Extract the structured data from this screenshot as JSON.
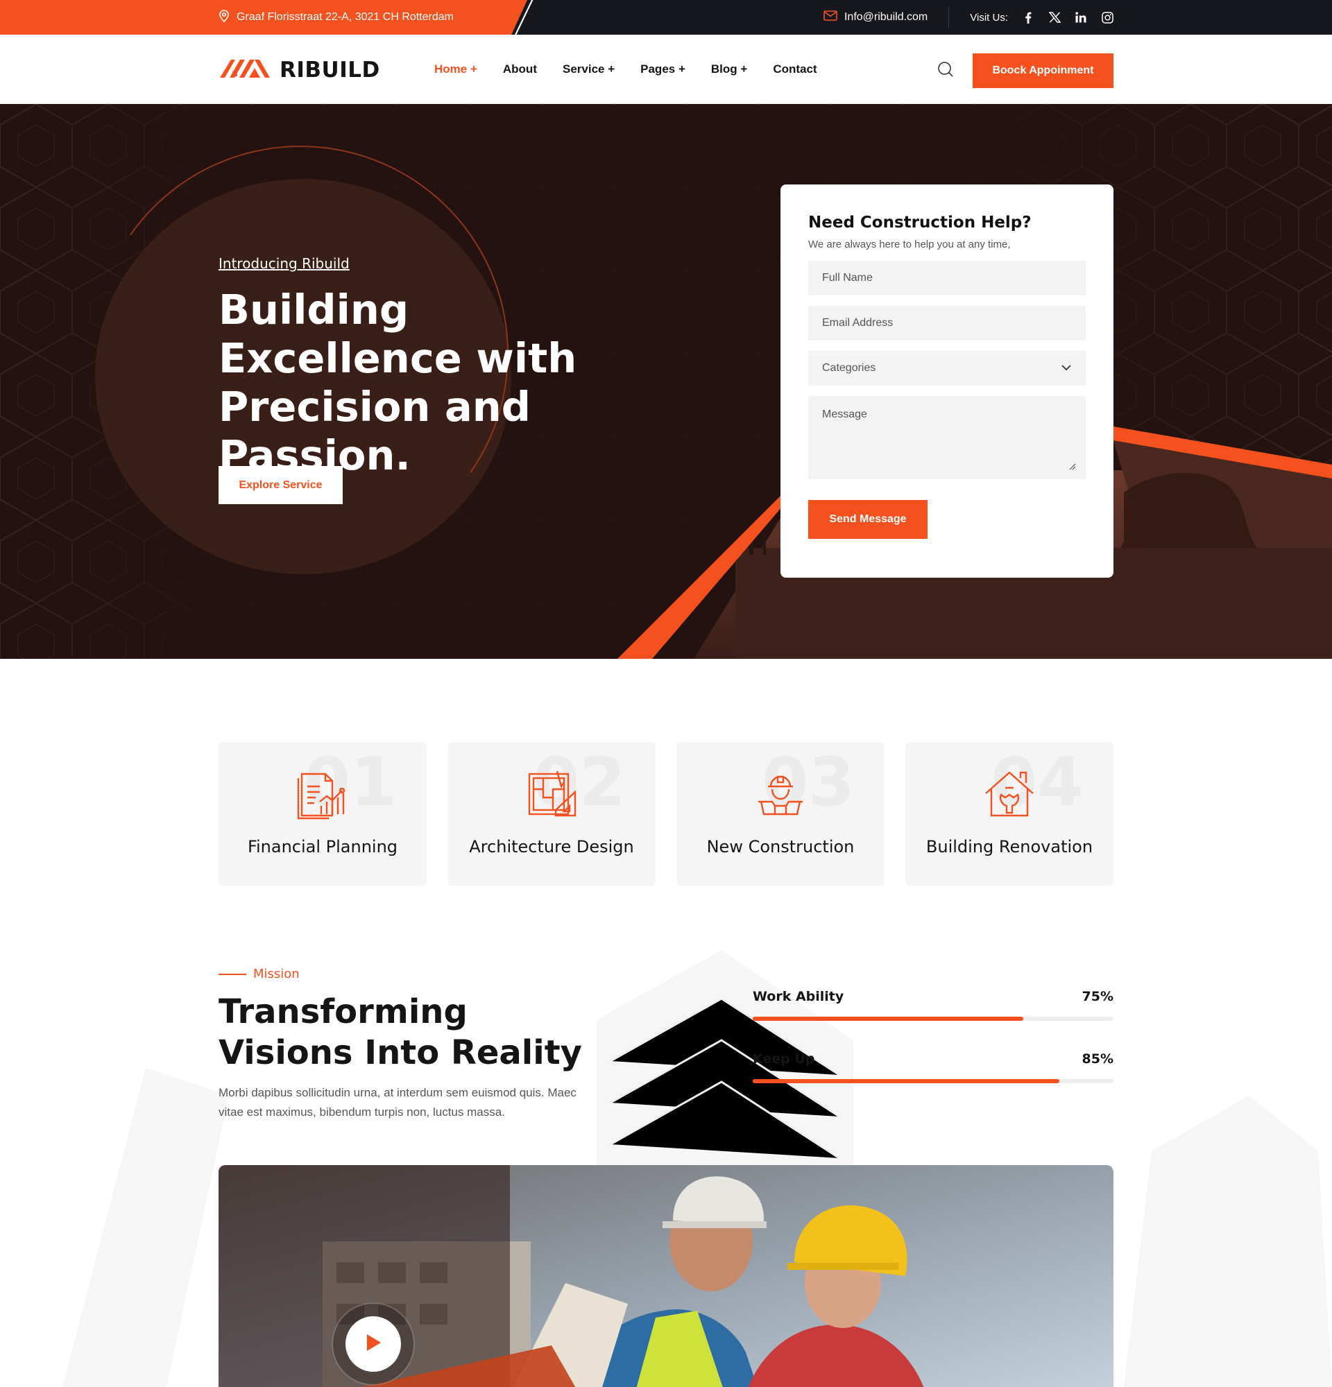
{
  "topbar": {
    "address": "Graaf Florisstraat 22-A, 3021 CH Rotterdam",
    "email": "Info@ribuild.com",
    "visit_label": "Visit Us:",
    "socials": [
      "facebook-icon",
      "x-icon",
      "linkedin-icon",
      "instagram-icon"
    ]
  },
  "header": {
    "brand": "RIBUILD",
    "nav": [
      "Home +",
      "About",
      "Service +",
      "Pages +",
      "Blog +",
      "Contact"
    ],
    "active_nav": "Home +",
    "cta": "Boock Appoinment"
  },
  "hero": {
    "intro": "Introducing Ribuild",
    "title": "Building Excellence with Precision and Passion.",
    "button": "Explore Service"
  },
  "form": {
    "title": "Need Construction Help?",
    "subtitle": "We are always here to help you at any time,",
    "full_name_placeholder": "Full Name",
    "email_placeholder": "Email Address",
    "category_selected": "Categories",
    "message_placeholder": "Message",
    "submit": "Send Message"
  },
  "services": [
    {
      "number": "01",
      "label": "Financial Planning",
      "icon": "financial-report-icon"
    },
    {
      "number": "02",
      "label": "Architecture Design",
      "icon": "blueprint-icon"
    },
    {
      "number": "03",
      "label": "New Construction",
      "icon": "worker-icon"
    },
    {
      "number": "04",
      "label": "Building Renovation",
      "icon": "house-repair-icon"
    }
  ],
  "mission": {
    "tag": "Mission",
    "title": "Transforming Visions Into Reality",
    "text": "Morbi dapibus sollicitudin urna, at interdum sem euismod quis. Maec vitae est maximus, bibendum turpis non, luctus massa.",
    "skills": [
      {
        "label": "Work Ability",
        "value_text": "75%",
        "value": 0.75
      },
      {
        "label": "Keep Up",
        "value_text": "85%",
        "value": 0.85
      }
    ]
  },
  "colors": {
    "accent": "#f5511e",
    "dark": "#16181d",
    "hero_bg": "#231210"
  }
}
